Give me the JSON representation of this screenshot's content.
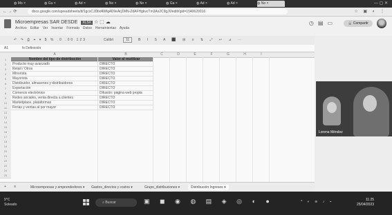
{
  "browser": {
    "tabs": [
      "Mo",
      "Gu",
      "Ad",
      "Ne",
      "Ne",
      "Ga",
      "Ad",
      "Ad",
      "Ne"
    ],
    "address": "docs.google.com/spreadsheets/d/1gcsCJDbd4Wlg4D9eArj1MN-ZdAFHgkvcTm3Ax2C9gJ0/edit#gid=1540620016"
  },
  "doc": {
    "title": "Microempresas SAR DESDE",
    "badge": "XLSX",
    "menu": [
      "Archivo",
      "Editar",
      "Ver",
      "Insertar",
      "Formato",
      "Datos",
      "Herramientas",
      "Ayuda"
    ],
    "share_label": "Compartir",
    "header_icons": [
      "history-icon",
      "comment-icon",
      "meet-icon"
    ]
  },
  "toolbar": {
    "zoom": "100%",
    "font": "Calibri",
    "font_size": "11",
    "cell_ref": "A1",
    "formula": "Definición"
  },
  "sheet": {
    "columns": [
      "A",
      "B",
      "C",
      "D",
      "E",
      "F",
      "G",
      "H",
      "I"
    ],
    "rows": [
      "1",
      "2",
      "3",
      "4",
      "5",
      "6",
      "7",
      "8",
      "9",
      "10",
      "11",
      "12",
      "13",
      "14",
      "15",
      "16",
      "17",
      "18",
      "19",
      "20",
      "21",
      "22",
      "23",
      "24",
      "25"
    ],
    "header": [
      "Nombre del tipo de distribución",
      "Valor al reutilizar"
    ],
    "data": [
      [
        "Producto muy avanzado",
        "DIRECTO"
      ],
      [
        "Retail / Otros",
        "DIRECTO"
      ],
      [
        "Minorista",
        "DIRECTO"
      ],
      [
        "Mayorista",
        "DIRECTO"
      ],
      [
        "Distribuidor, almacenes y distribuidores",
        "DIRECTO"
      ],
      [
        "Exportación",
        "DIRECTO"
      ],
      [
        "Comercio electrónico",
        "Difusión: página web propia"
      ],
      [
        "Redes sociales, venta directa a clientes",
        "DIRECTO"
      ],
      [
        "Marketplace, plataformas",
        "DIRECTO"
      ],
      [
        "Ferias y ventas al por mayor",
        "DIRECTO"
      ]
    ]
  },
  "sheet_tabs": [
    "Microempresas y emprendedores",
    "Gastos_directos y costos",
    "Grupo_distribuciones",
    "Distribución Ingresos"
  ],
  "active_sheet_index": 3,
  "video": {
    "participant": "Lorena Méndez"
  },
  "taskbar": {
    "weather_temp": "9°C",
    "weather_text": "Soleado",
    "search_label": "Buscar",
    "time": "11:25",
    "date": "25/04/2023"
  }
}
